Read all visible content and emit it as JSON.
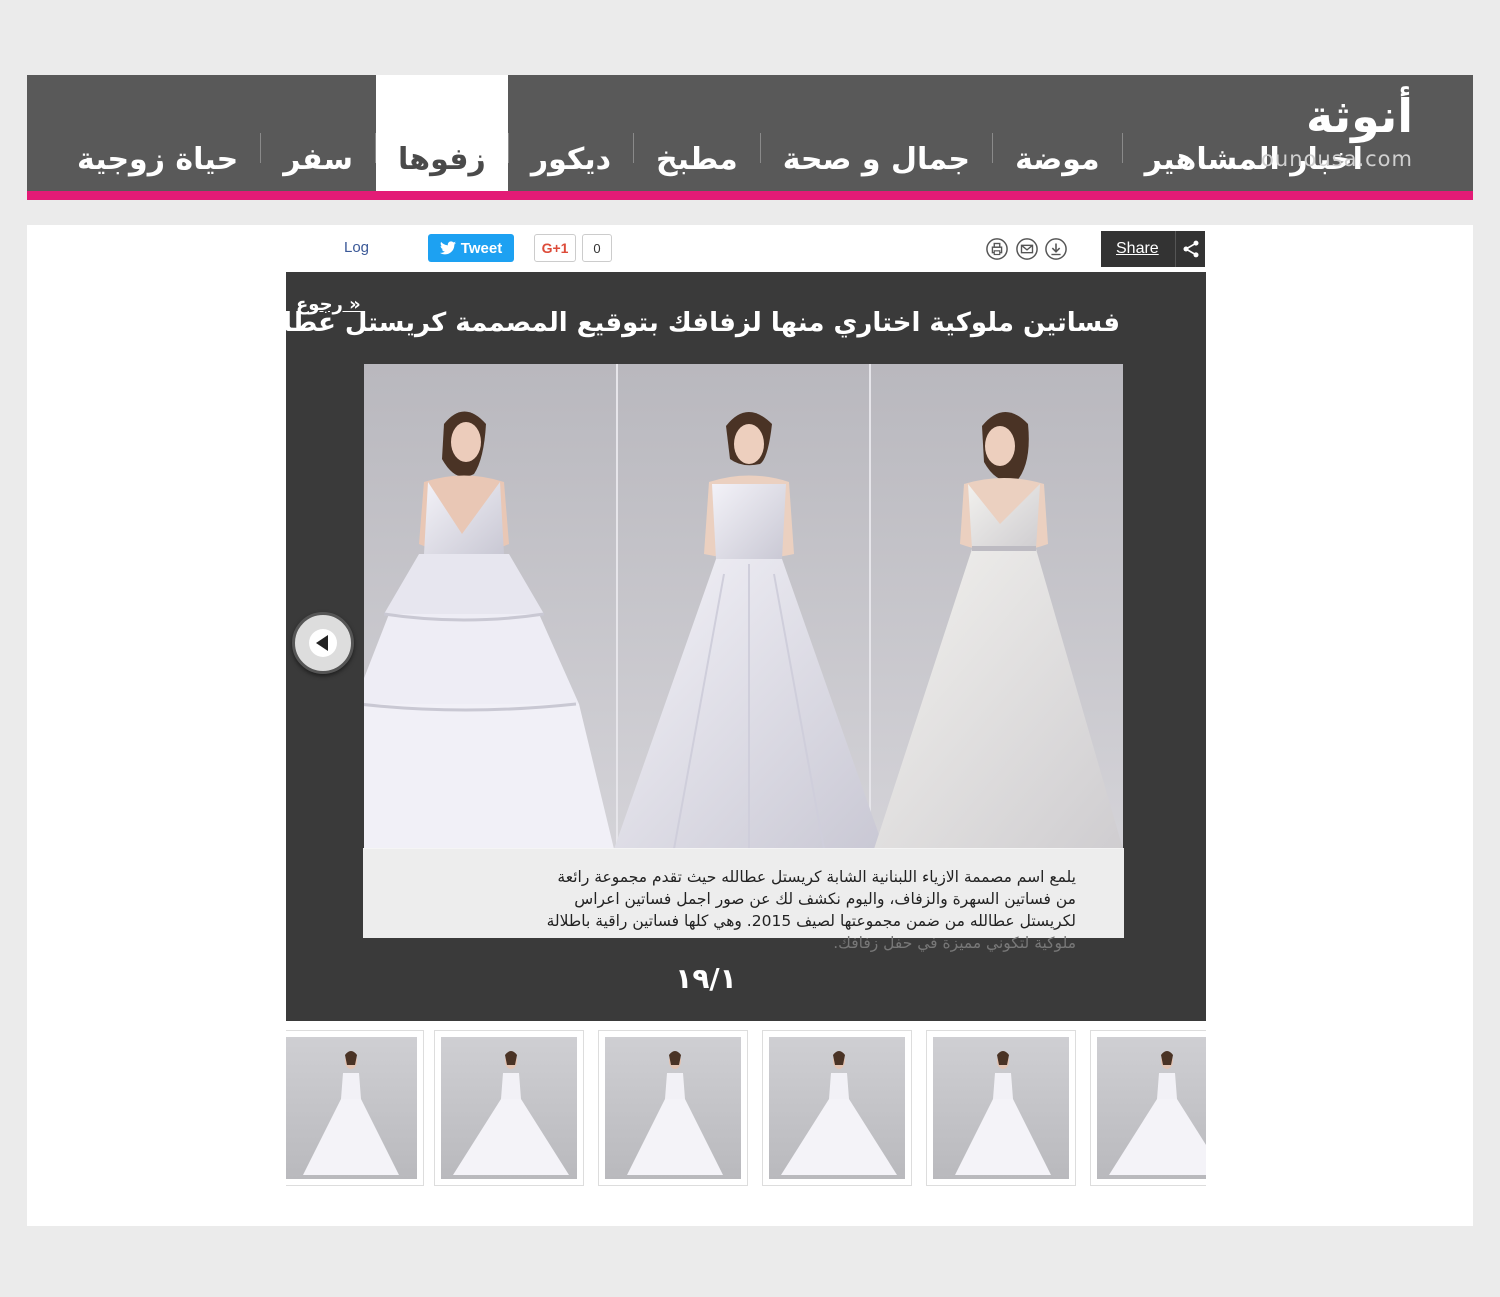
{
  "logo": {
    "arabic": "أنوثة",
    "domain": "ounousa.com"
  },
  "nav": {
    "items": [
      {
        "label": "اخبار المشاهير",
        "active": false
      },
      {
        "label": "موضة",
        "active": false
      },
      {
        "label": "جمال و صحة",
        "active": false
      },
      {
        "label": "مطبخ",
        "active": false
      },
      {
        "label": "ديكور",
        "active": false
      },
      {
        "label": "زفوها",
        "active": true
      },
      {
        "label": "سفر",
        "active": false
      },
      {
        "label": "حياة زوجية",
        "active": false
      }
    ]
  },
  "toolbar": {
    "log_label": "Log",
    "tweet_label": "Tweet",
    "gplus_label": "G+1",
    "gplus_count": "0",
    "share_label": "Share",
    "icons": [
      "print-icon",
      "mail-icon",
      "download-icon",
      "share-icon"
    ]
  },
  "gallery": {
    "title": "فساتين ملوكية اختاري منها لزفافك بتوقيع المصممة كريستل عطالله",
    "back_label": "« رجوع",
    "caption_lines": [
      "يلمع اسم مصممة الازياء اللبنانية الشابة كريستل عطالله حيث تقدم مجموعة رائعة",
      "من فساتين السهرة والزفاف، واليوم نكشف لك عن صور اجمل فساتين اعراس",
      "لكريستل عطالله من ضمن مجموعتها لصيف 2015. وهي كلها فساتين راقية باطلالة",
      "ملوكية لتكوني مميزة في حفل زفافك."
    ],
    "counter": "١٩/١",
    "thumbnail_count": 6
  },
  "colors": {
    "header_bg": "#595959",
    "accent": "#e31b76",
    "gallery_bg": "#3a3a3a"
  }
}
